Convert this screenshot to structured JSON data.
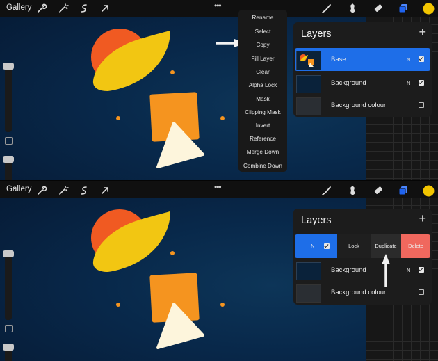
{
  "toolbar": {
    "gallery_label": "Gallery",
    "more_label": "•••",
    "accent_color": "#1f63f0",
    "color_swatch": "#f2c500"
  },
  "context_menu": {
    "items": [
      "Rename",
      "Select",
      "Copy",
      "Fill Layer",
      "Clear",
      "Alpha Lock",
      "Mask",
      "Clipping Mask",
      "Invert",
      "Reference",
      "Merge Down",
      "Combine Down"
    ]
  },
  "layers_top": {
    "title": "Layers",
    "add_label": "+",
    "rows": [
      {
        "name": "Base",
        "blend": "N",
        "visible": true,
        "selected": true
      },
      {
        "name": "Background",
        "blend": "N",
        "visible": true,
        "selected": false
      },
      {
        "name": "Background colour",
        "blend": "",
        "visible": false,
        "selected": false
      }
    ]
  },
  "layers_bottom": {
    "title": "Layers",
    "add_label": "+",
    "selected_blend": "N",
    "swipe_actions": {
      "lock": "Lock",
      "duplicate": "Duplicate",
      "delete": "Delete"
    },
    "rows": [
      {
        "name": "Background",
        "blend": "N",
        "visible": true
      },
      {
        "name": "Background colour",
        "blend": "",
        "visible": false
      }
    ]
  },
  "colors": {
    "canvas_bg": "#08284a",
    "orange_circle": "#f05a22",
    "yellow_leaf": "#f2c612",
    "orange_square": "#f5941f",
    "cream_triangle": "#fdf5dc",
    "dot": "#f5941f",
    "delete_red": "#f0685e",
    "layer_selected": "#1e6ee8"
  }
}
